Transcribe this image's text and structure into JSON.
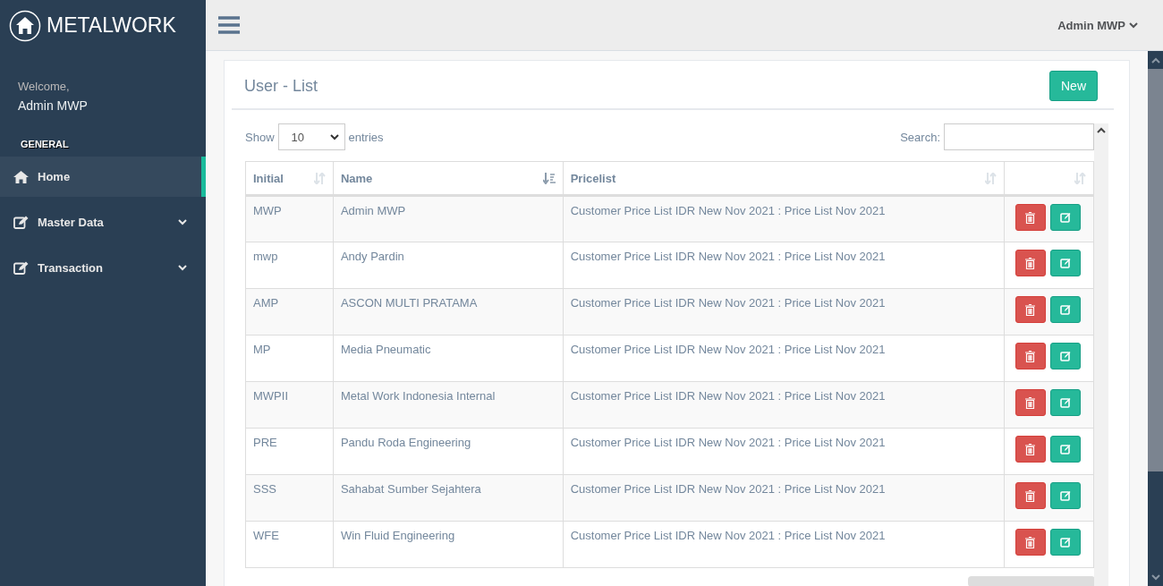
{
  "brand": {
    "title": "METALWORK"
  },
  "profile": {
    "greeting": "Welcome,",
    "name": "Admin MWP"
  },
  "sidebar": {
    "section": "GENERAL",
    "items": [
      {
        "label": "Home",
        "kind": "home",
        "selected": true,
        "expandable": false
      },
      {
        "label": "Master Data",
        "kind": "edit",
        "selected": false,
        "expandable": true
      },
      {
        "label": "Transaction",
        "kind": "edit",
        "selected": false,
        "expandable": true
      }
    ]
  },
  "topbar": {
    "user": "Admin MWP"
  },
  "panel": {
    "title": "User - List",
    "new_button": "New"
  },
  "length_control": {
    "before": "Show",
    "value": "10",
    "after": "entries"
  },
  "search": {
    "label": "Search:"
  },
  "table": {
    "columns": [
      {
        "label": "Initial",
        "sorted": false
      },
      {
        "label": "Name",
        "sorted": true
      },
      {
        "label": "Pricelist",
        "sorted": false
      },
      {
        "sorted": false
      }
    ],
    "rows": [
      {
        "initial": "MWP",
        "name": "Admin MWP",
        "pricelist": "Customer Price List IDR New Nov 2021 : Price List Nov 2021"
      },
      {
        "initial": "mwp",
        "name": "Andy Pardin",
        "pricelist": "Customer Price List IDR New Nov 2021 : Price List Nov 2021"
      },
      {
        "initial": "AMP",
        "name": "ASCON MULTI PRATAMA",
        "pricelist": "Customer Price List IDR New Nov 2021 : Price List Nov 2021"
      },
      {
        "initial": "MP",
        "name": "Media Pneumatic",
        "pricelist": "Customer Price List IDR New Nov 2021 : Price List Nov 2021"
      },
      {
        "initial": "MWPII",
        "name": "Metal Work Indonesia Internal",
        "pricelist": "Customer Price List IDR New Nov 2021 : Price List Nov 2021"
      },
      {
        "initial": "PRE",
        "name": "Pandu Roda Engineering",
        "pricelist": "Customer Price List IDR New Nov 2021 : Price List Nov 2021"
      },
      {
        "initial": "SSS",
        "name": "Sahabat Sumber Sejahtera",
        "pricelist": "Customer Price List IDR New Nov 2021 : Price List Nov 2021"
      },
      {
        "initial": "WFE",
        "name": "Win Fluid Engineering",
        "pricelist": "Customer Price List IDR New Nov 2021 : Price List Nov 2021"
      }
    ]
  }
}
